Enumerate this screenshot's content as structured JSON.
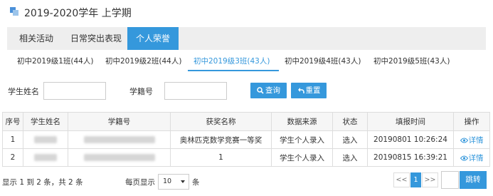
{
  "header": {
    "title": "2019-2020学年 上学期",
    "icon": "semester-icon"
  },
  "main_tabs": [
    {
      "label": "相关活动",
      "active": false
    },
    {
      "label": "日常突出表现",
      "active": false
    },
    {
      "label": "个人荣誉",
      "active": true
    }
  ],
  "class_tabs": [
    {
      "label": "初中2019级1班(44人)",
      "active": false
    },
    {
      "label": "初中2019级2班(44人)",
      "active": false
    },
    {
      "label": "初中2019级3班(43人)",
      "active": true
    },
    {
      "label": "初中2019级4班(43人)",
      "active": false
    },
    {
      "label": "初中2019级5班(43人)",
      "active": false
    }
  ],
  "search": {
    "name_label": "学生姓名",
    "name_value": "",
    "id_label": "学籍号",
    "id_value": "",
    "query_label": "查询",
    "reset_label": "重置"
  },
  "table": {
    "columns": [
      "序号",
      "学生姓名",
      "学籍号",
      "获奖名称",
      "数据来源",
      "状态",
      "填报时间",
      "操作"
    ],
    "rows": [
      {
        "seq": "1",
        "award": "奥林匹克数学竞赛一等奖",
        "source": "学生个人录入",
        "status": "选入",
        "time": "20190801 10:26:24",
        "action": "详情"
      },
      {
        "seq": "2",
        "award": "1",
        "source": "学生个人录入",
        "status": "选入",
        "time": "20190815 16:39:21",
        "action": "详情"
      }
    ]
  },
  "footer": {
    "summary": "显示 1 到 2 条，共 2 条",
    "page_size_label": "每页显示",
    "page_size_value": "10",
    "page_size_unit": "条",
    "prev": "<<",
    "current_page": "1",
    "next": ">>",
    "jump_value": "",
    "jump_label": "跳转"
  },
  "colors": {
    "accent": "#3598dc",
    "tab_bg": "#eeeeee",
    "border": "#dddddd"
  }
}
